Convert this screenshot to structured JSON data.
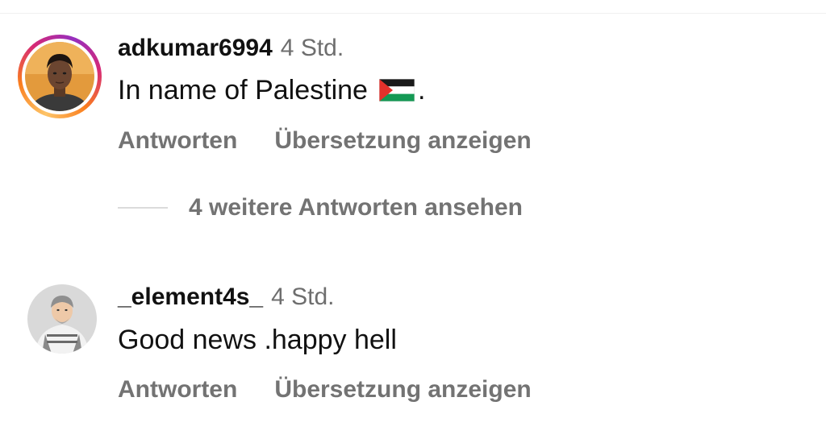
{
  "comments": [
    {
      "username": "adkumar6994",
      "time": "4 Std.",
      "text": "In name of Palestine",
      "trailing": ".",
      "flag_icon": "palestine-flag-icon",
      "reply_label": "Antworten",
      "translate_label": "Übersetzung anzeigen",
      "has_story_ring": true
    },
    {
      "username": "_element4s_",
      "time": "4 Std.",
      "text": "Good news .happy hell",
      "reply_label": "Antworten",
      "translate_label": "Übersetzung anzeigen",
      "has_story_ring": false
    }
  ],
  "more_replies": {
    "label": "4 weitere Antworten ansehen"
  },
  "colors": {
    "primary_text": "#111111",
    "secondary_text": "#737373",
    "story_ring": [
      "#fdc468",
      "#fa7e1e",
      "#d62976",
      "#962fbf"
    ]
  }
}
